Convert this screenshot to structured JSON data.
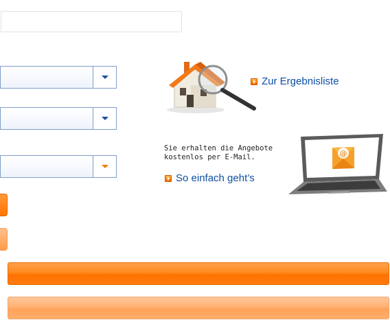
{
  "form": {
    "top_field": {
      "value": ""
    },
    "select_1": {
      "value": ""
    },
    "select_2": {
      "value": ""
    },
    "select_3": {
      "value": ""
    }
  },
  "links": {
    "results": "Zur Ergebnisliste",
    "how_it_works": "So einfach geht’s"
  },
  "info": {
    "line1": "Sie erhalten die Angebote",
    "line2": "kostenlos per E-Mail."
  },
  "icons": {
    "house": "house-magnifier-icon",
    "laptop": "laptop-email-icon",
    "arrow": "orange-arrow-bullet-icon"
  },
  "colors": {
    "accent": "#ff7300",
    "link": "#0e4ea3",
    "select_border": "#7f9dc9"
  }
}
